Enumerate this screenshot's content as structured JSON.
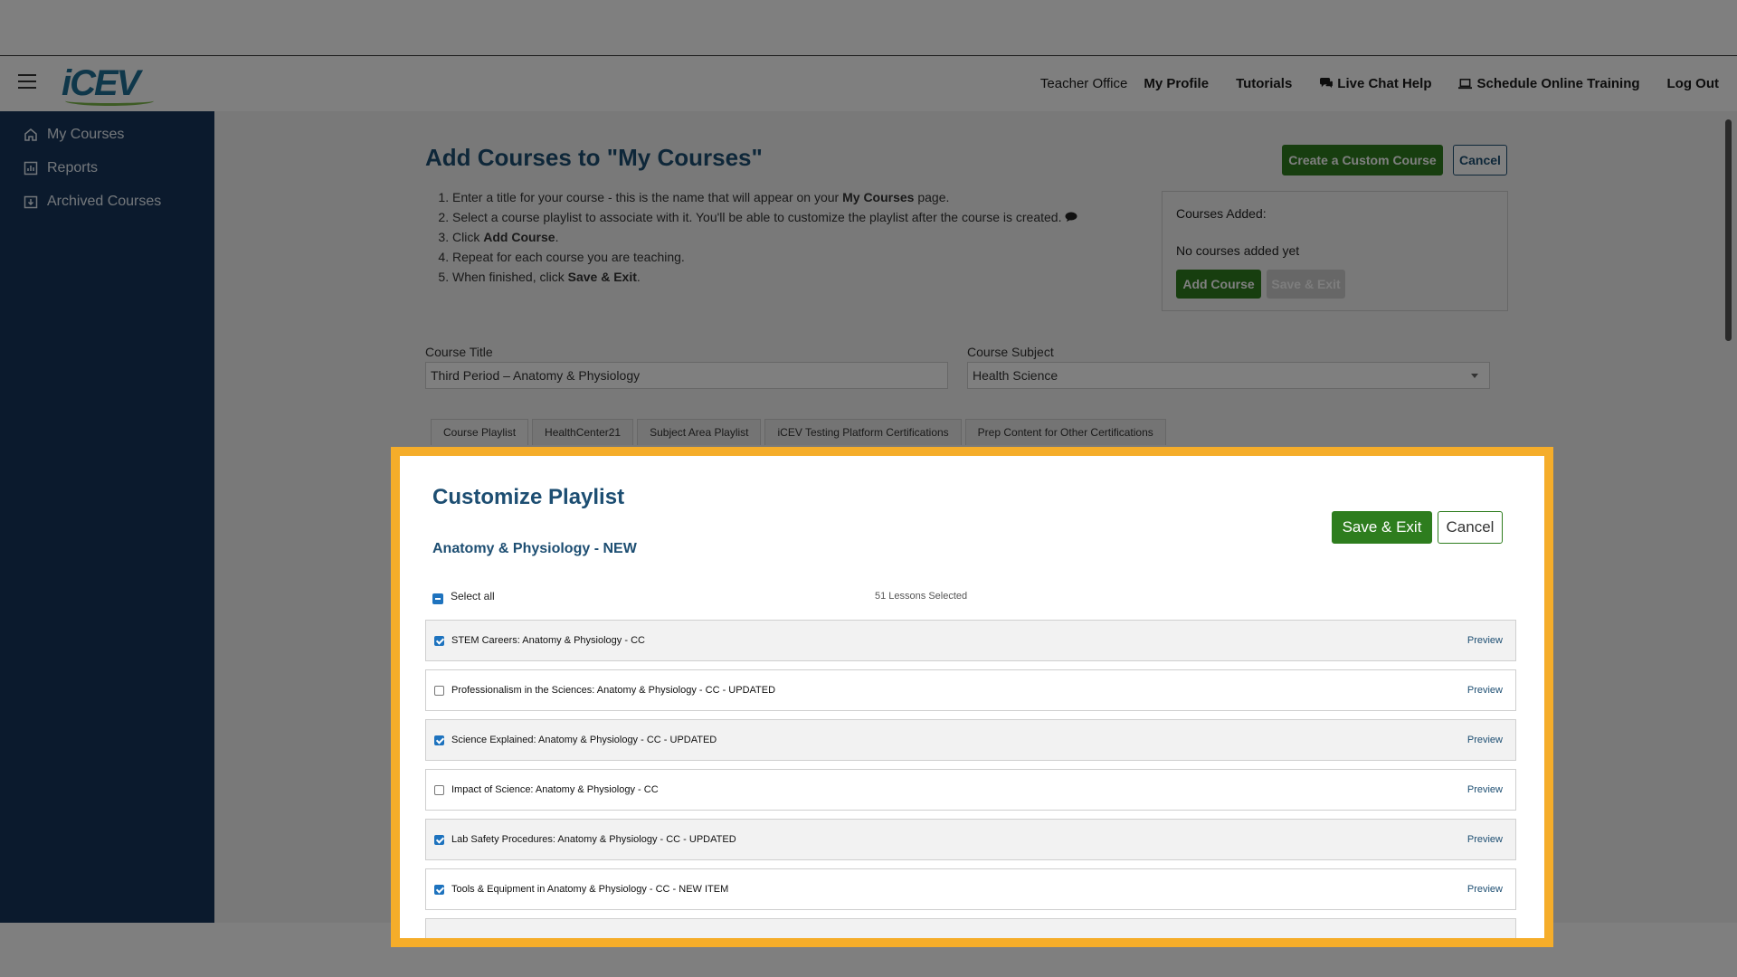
{
  "topbar": {
    "logo": "iCEV",
    "nav": [
      "Teacher Office",
      "My Profile",
      "Tutorials",
      "Live Chat Help",
      "Schedule Online Training",
      "Log Out"
    ]
  },
  "sidebar": {
    "items": [
      {
        "label": "My Courses",
        "icon": "home-icon"
      },
      {
        "label": "Reports",
        "icon": "chart-icon"
      },
      {
        "label": "Archived Courses",
        "icon": "archive-icon"
      }
    ]
  },
  "page": {
    "title": "Add Courses to \"My Courses\"",
    "create_custom": "Create a Custom Course",
    "cancel": "Cancel",
    "instructions": [
      {
        "pre": "Enter a title for your course - this is the name that will appear on your ",
        "bold": "My Courses",
        "post": " page."
      },
      {
        "pre": "Select a course playlist to associate with it. You'll be able to customize the playlist after the course is created. ",
        "bold": "",
        "post": ""
      },
      {
        "pre": "Click ",
        "bold": "Add Course",
        "post": "."
      },
      {
        "pre": "Repeat for each course you are teaching.",
        "bold": "",
        "post": ""
      },
      {
        "pre": "When finished, click ",
        "bold": "Save & Exit",
        "post": "."
      }
    ],
    "courses_added_label": "Courses Added:",
    "no_courses": "No courses added yet",
    "add_course": "Add Course",
    "save_exit": "Save & Exit",
    "course_title_label": "Course Title",
    "course_title_value": "Third Period – Anatomy & Physiology",
    "course_subject_label": "Course Subject",
    "course_subject_value": "Health Science",
    "tabs": [
      "Course Playlist",
      "HealthCenter21",
      "Subject Area Playlist",
      "iCEV Testing Platform Certifications",
      "Prep Content for Other Certifications"
    ]
  },
  "dialog": {
    "title": "Customize Playlist",
    "subtitle": "Anatomy & Physiology - NEW",
    "save_exit": "Save & Exit",
    "cancel": "Cancel",
    "select_all": "Select all",
    "lessons_selected": "51 Lessons Selected",
    "preview_label": "Preview",
    "lessons": [
      {
        "label": "STEM Careers: Anatomy & Physiology - CC",
        "checked": true
      },
      {
        "label": "Professionalism in the Sciences: Anatomy & Physiology - CC - UPDATED",
        "checked": false
      },
      {
        "label": "Science Explained: Anatomy & Physiology - CC - UPDATED",
        "checked": true
      },
      {
        "label": "Impact of Science: Anatomy & Physiology - CC",
        "checked": false
      },
      {
        "label": "Lab Safety Procedures: Anatomy & Physiology - CC - UPDATED",
        "checked": true
      },
      {
        "label": "Tools & Equipment in Anatomy & Physiology - CC - NEW ITEM",
        "checked": true
      }
    ]
  },
  "colors": {
    "brand_navy": "#16355a",
    "title_blue": "#1d4e72",
    "green": "#2e7d1e",
    "highlight": "#f5ad2a"
  }
}
